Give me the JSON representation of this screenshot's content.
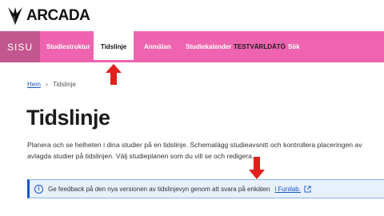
{
  "brand": {
    "name": "ARCADA"
  },
  "nav": {
    "logo": "SISU",
    "items": [
      {
        "label": "Studiestruktur"
      },
      {
        "label": "Tidslinje"
      },
      {
        "label": "Anmälan"
      },
      {
        "label": "Studiekalender"
      },
      {
        "label": "TESTVÄRLDÄTÖ"
      },
      {
        "label": "Sök"
      }
    ]
  },
  "breadcrumb": {
    "home": "Hem",
    "current": "Tidslinje"
  },
  "page": {
    "title": "Tidslinje",
    "description": "Planera och se helheten i dina studier på en tidslinje. Schemalägg studieavsnitt och kontrollera placeringen av avlagda studier på tidslinjen. Välj studieplanen som du vill se och redigera."
  },
  "banner": {
    "text": "Ge feedback på den nya versionen av tidslinjevyn genom att svara på enkäten",
    "link": "i Funilab."
  },
  "colors": {
    "nav": "#ef64b0",
    "nav_logo": "#c2578f",
    "link": "#1a56c4",
    "arrow": "#e0201c"
  },
  "icons": [
    "arcada-logo-icon",
    "info-icon",
    "external-link-icon",
    "breadcrumb-chevron-icon",
    "red-arrow-icon"
  ]
}
